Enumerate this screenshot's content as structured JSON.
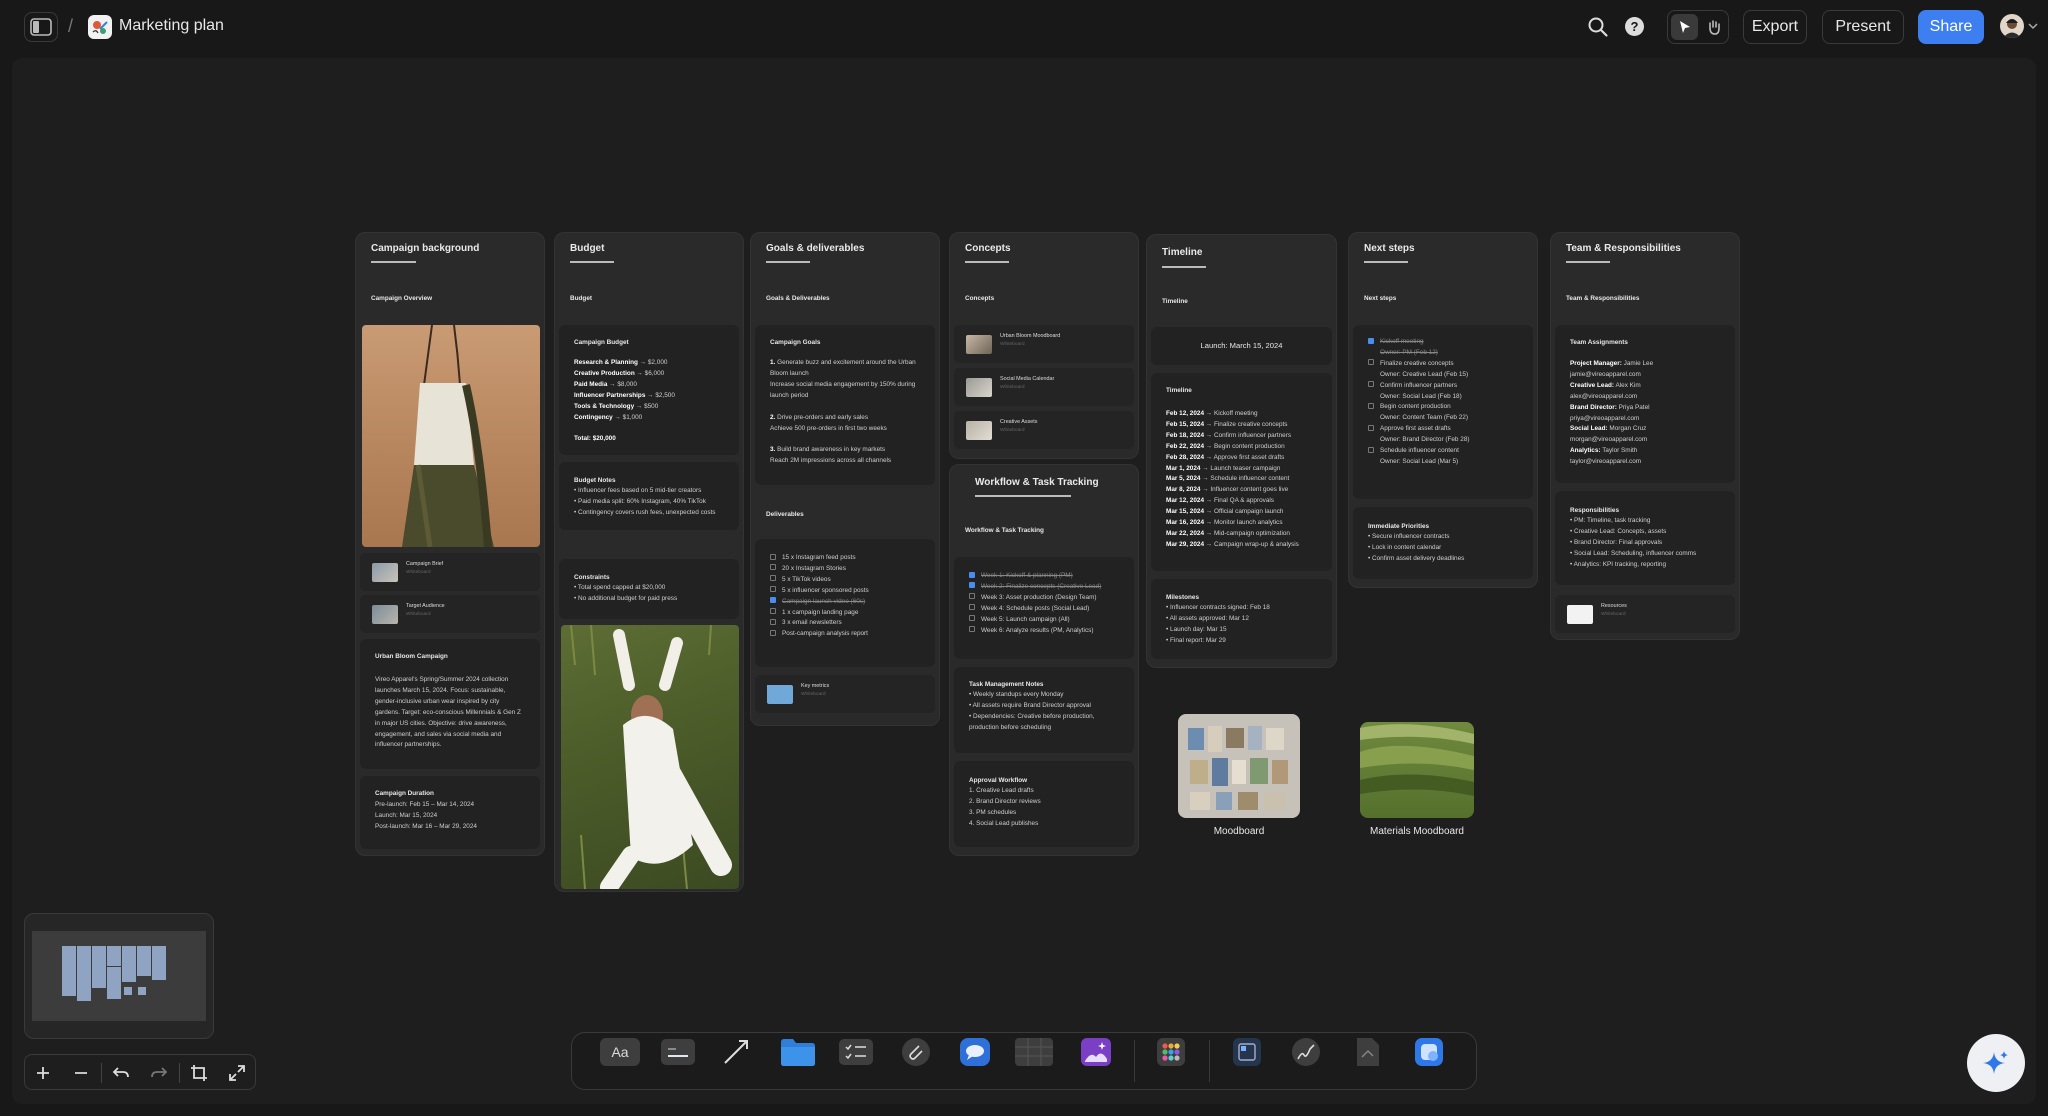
{
  "topbar": {
    "title": "Marketing plan",
    "separator": "/",
    "export_label": "Export",
    "present_label": "Present",
    "share_label": "Share"
  },
  "colors": {
    "accent": "#3d7ff0",
    "canvas": "#1e1e1e",
    "board": "#2a2a2a",
    "card": "#222222"
  },
  "boards": {
    "campaign": {
      "title": "Campaign background",
      "overview": "Campaign Overview",
      "files": [
        {
          "label": "Campaign Brief",
          "sub": "Whiteboard"
        },
        {
          "label": "Target Audience",
          "sub": "Whiteboard"
        }
      ],
      "urban": {
        "heading": "Urban Bloom Campaign",
        "lines": [
          "Vireo Apparel's Spring/Summer 2024 collection",
          "launches March 15, 2024. Focus: sustainable,",
          "gender-inclusive urban wear inspired by city",
          "gardens. Target: eco-conscious Millennials & Gen Z",
          "in major US cities. Objective: drive awareness,",
          "engagement, and sales via social media and",
          "influencer partnerships."
        ]
      },
      "duration": {
        "heading": "Campaign Duration",
        "lines": [
          "Pre-launch: Feb 15 – Mar 14, 2024",
          "Launch: Mar 15, 2024",
          "Post-launch: Mar 16 – Mar 29, 2024"
        ]
      }
    },
    "budget": {
      "title": "Budget",
      "subtitle": "Budget",
      "card_heading": "Campaign Budget",
      "items": [
        {
          "k": "Research & Planning",
          "v": " → $2,000"
        },
        {
          "k": "Creative Production",
          "v": " → $6,000"
        },
        {
          "k": "Paid Media",
          "v": " → $8,000"
        },
        {
          "k": "Influencer Partnerships",
          "v": " → $2,500"
        },
        {
          "k": "Tools & Technology",
          "v": " → $500"
        },
        {
          "k": "Contingency",
          "v": " → $1,000"
        }
      ],
      "total": "Total: $20,000",
      "notes": {
        "heading": "Budget Notes",
        "lines": [
          "• Influencer fees based on 5 mid-tier creators",
          "• Paid media split: 60% Instagram, 40% TikTok",
          "• Contingency covers rush fees, unexpected costs"
        ]
      },
      "constraints": {
        "heading": "Constraints",
        "lines": [
          "• Total spend capped at $20,000",
          "• No additional budget for paid press"
        ]
      }
    },
    "goals": {
      "title": "Goals & deliverables",
      "subtitle": "Goals & Deliverables",
      "card_heading": "Campaign Goals",
      "goals": [
        {
          "n": "1.",
          "lines": [
            "Generate buzz and excitement around the Urban",
            "Bloom launch",
            "Increase social media engagement by 150% during",
            "launch period"
          ]
        },
        {
          "n": "2.",
          "lines": [
            "Drive pre-orders and early sales",
            "Achieve 500 pre-orders in first two weeks"
          ]
        },
        {
          "n": "3.",
          "lines": [
            "Build brand awareness in key markets",
            "Reach 2M impressions across all channels"
          ]
        }
      ],
      "deliverables_heading": "Deliverables",
      "deliverables": [
        {
          "text": "15 x Instagram feed posts",
          "done": false
        },
        {
          "text": "20 x Instagram Stories",
          "done": false
        },
        {
          "text": "5 x TikTok videos",
          "done": false
        },
        {
          "text": "5 x influencer sponsored posts",
          "done": false
        },
        {
          "text": "Campaign launch video (60s)",
          "done": true
        },
        {
          "text": "1 x campaign landing page",
          "done": false
        },
        {
          "text": "3 x email newsletters",
          "done": false
        },
        {
          "text": "Post-campaign analysis report",
          "done": false
        }
      ],
      "folder": {
        "label": "Key metrics",
        "sub": "Whiteboard"
      }
    },
    "concepts": {
      "title": "Concepts",
      "subtitle": "Concepts",
      "files": [
        {
          "label": "Urban Bloom Moodboard",
          "sub": "Whiteboard"
        },
        {
          "label": "Social Media Calendar",
          "sub": "Whiteboard"
        },
        {
          "label": "Creative Assets",
          "sub": "Whiteboard"
        }
      ]
    },
    "workflow": {
      "title": "Workflow & Task Tracking",
      "subtitle": "Workflow & Task Tracking",
      "tasks": [
        {
          "text": "Week 1: Kickoff & planning (PM)",
          "done": true
        },
        {
          "text": "Week 2: Finalize concepts (Creative Lead)",
          "done": true
        },
        {
          "text": "Week 3: Asset production (Design Team)",
          "done": false
        },
        {
          "text": "Week 4: Schedule posts (Social Lead)",
          "done": false
        },
        {
          "text": "Week 5: Launch campaign (All)",
          "done": false
        },
        {
          "text": "Week 6: Analyze results (PM, Analytics)",
          "done": false
        }
      ],
      "notes": {
        "heading": "Task Management Notes",
        "lines": [
          "• Weekly standups every Monday",
          "• All assets require Brand Director approval",
          "• Dependencies: Creative before production,",
          "production before scheduling"
        ]
      },
      "approval": {
        "heading": "Approval Workflow",
        "lines": [
          "1. Creative Lead drafts",
          "2. Brand Director reviews",
          "3. PM schedules",
          "4. Social Lead publishes"
        ]
      }
    },
    "timeline": {
      "title": "Timeline",
      "subtitle": "Timeline",
      "launch": "Launch: March 15, 2024",
      "card_heading": "Timeline",
      "events": [
        {
          "d": "Feb 12, 2024",
          "e": " → Kickoff meeting"
        },
        {
          "d": "Feb 15, 2024",
          "e": " → Finalize creative concepts"
        },
        {
          "d": "Feb 18, 2024",
          "e": " → Confirm influencer partners"
        },
        {
          "d": "Feb 22, 2024",
          "e": " → Begin content production"
        },
        {
          "d": "Feb 28, 2024",
          "e": " → Approve first asset drafts"
        },
        {
          "d": "Mar 1, 2024",
          "e": " → Launch teaser campaign"
        },
        {
          "d": "Mar 5, 2024",
          "e": " → Schedule influencer content"
        },
        {
          "d": "Mar 8, 2024",
          "e": " → Influencer content goes live"
        },
        {
          "d": "Mar 12, 2024",
          "e": " → Final QA & approvals"
        },
        {
          "d": "Mar 15, 2024",
          "e": " → Official campaign launch"
        },
        {
          "d": "Mar 16, 2024",
          "e": " → Monitor launch analytics"
        },
        {
          "d": "Mar 22, 2024",
          "e": " → Mid-campaign optimization"
        },
        {
          "d": "Mar 29, 2024",
          "e": " → Campaign wrap-up & analysis"
        }
      ],
      "milestones": {
        "heading": "Milestones",
        "lines": [
          "• Influencer contracts signed: Feb 18",
          "• All assets approved: Mar 12",
          "• Launch day: Mar 15",
          "• Final report: Mar 29"
        ]
      }
    },
    "next": {
      "title": "Next steps",
      "subtitle": "Next steps",
      "steps": [
        {
          "text": "Kickoff meeting",
          "owner": "Owner: PM (Feb 12)",
          "done": true
        },
        {
          "text": "Finalize creative concepts",
          "owner": "Owner: Creative Lead (Feb 15)",
          "done": false
        },
        {
          "text": "Confirm influencer partners",
          "owner": "Owner: Social Lead (Feb 18)",
          "done": false
        },
        {
          "text": "Begin content production",
          "owner": "Owner: Content Team (Feb 22)",
          "done": false
        },
        {
          "text": "Approve first asset drafts",
          "owner": "Owner: Brand Director (Feb 28)",
          "done": false
        },
        {
          "text": "Schedule influencer content",
          "owner": "Owner: Social Lead (Mar 5)",
          "done": false
        }
      ],
      "priorities": {
        "heading": "Immediate Priorities",
        "lines": [
          "• Secure influencer contracts",
          "• Lock in content calendar",
          "• Confirm asset delivery deadlines"
        ]
      }
    },
    "team": {
      "title": "Team & Responsibilities",
      "subtitle": "Team & Responsibilities",
      "card_heading": "Team Assignments",
      "members": [
        {
          "role": "Project Manager:",
          "name": " Jamie Lee",
          "email": "jamie@vireoapparel.com"
        },
        {
          "role": "Creative Lead:",
          "name": " Alex Kim",
          "email": "alex@vireoapparel.com"
        },
        {
          "role": "Brand Director:",
          "name": " Priya Patel",
          "email": "priya@vireoapparel.com"
        },
        {
          "role": "Social Lead:",
          "name": " Morgan Cruz",
          "email": "morgan@vireoapparel.com"
        },
        {
          "role": "Analytics:",
          "name": " Taylor Smith",
          "email": "taylor@vireoapparel.com"
        }
      ],
      "resp": {
        "heading": "Responsibilities",
        "lines": [
          "• PM: Timeline, task tracking",
          "• Creative Lead: Concepts, assets",
          "• Brand Director: Final approvals",
          "• Social Lead: Scheduling, influencer comms",
          "• Analytics: KPI tracking, reporting"
        ]
      },
      "resources": {
        "label": "Resources",
        "sub": "Whiteboard"
      }
    }
  },
  "free_items": {
    "moodboard": "Moodboard",
    "materials": "Materials Moodboard"
  }
}
